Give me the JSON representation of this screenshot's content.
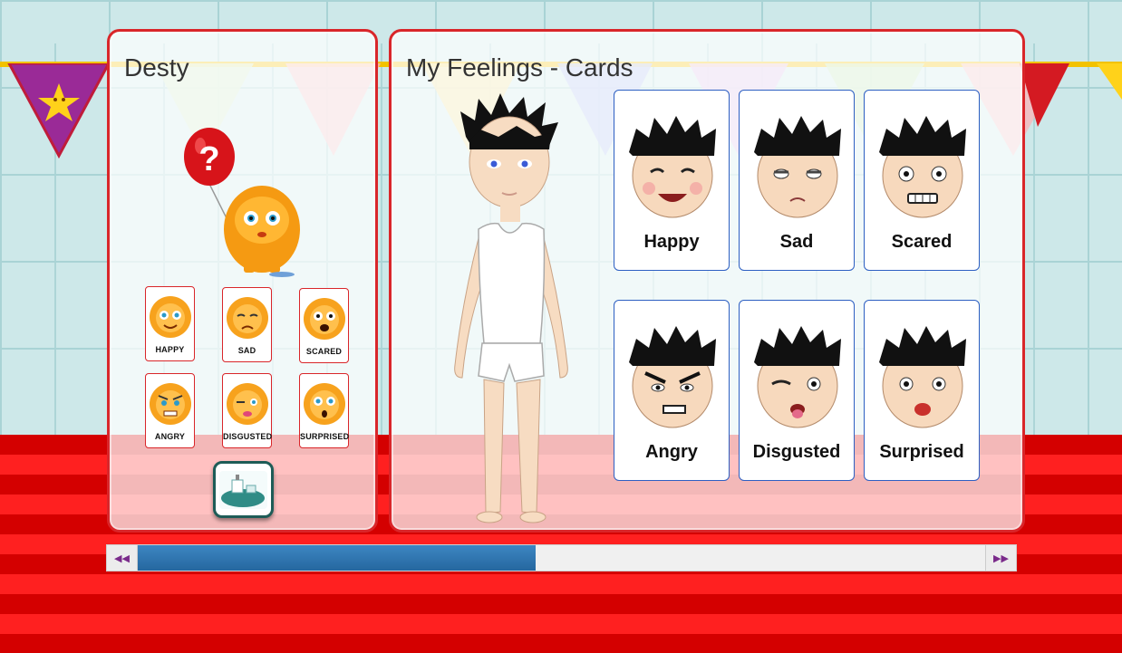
{
  "colors": {
    "accent": "#d9262a",
    "card_border": "#2d5fc2",
    "scroll_thumb": "#2c6fa8",
    "scroll_arrow": "#7a2a8a"
  },
  "left_panel": {
    "title": "Desty",
    "mascot_icon": "orange-monster-with-question-balloon-icon",
    "mini_cards": [
      {
        "label": "HAPPY",
        "icon": "happy-monster-icon"
      },
      {
        "label": "SAD",
        "icon": "sad-monster-icon"
      },
      {
        "label": "SCARED",
        "icon": "scared-monster-icon"
      },
      {
        "label": "ANGRY",
        "icon": "angry-monster-icon"
      },
      {
        "label": "DISGUSTED",
        "icon": "disgusted-monster-icon"
      },
      {
        "label": "SURPRISED",
        "icon": "surprised-monster-icon"
      }
    ],
    "game_button_icon": "landscape-scene-icon"
  },
  "right_panel": {
    "title": "My Feelings - Cards",
    "doll_icon": "paper-doll-boy-icon",
    "cards": [
      {
        "label": "Happy",
        "icon": "happy-face-icon"
      },
      {
        "label": "Sad",
        "icon": "sad-face-icon"
      },
      {
        "label": "Scared",
        "icon": "scared-face-icon"
      },
      {
        "label": "Angry",
        "icon": "angry-face-icon"
      },
      {
        "label": "Disgusted",
        "icon": "disgusted-face-icon"
      },
      {
        "label": "Surprised",
        "icon": "surprised-face-icon"
      }
    ]
  },
  "scrollbar": {
    "position_fraction": 0.0,
    "visible_fraction": 0.47,
    "left_icon": "double-chevron-left-icon",
    "right_icon": "double-chevron-right-icon"
  }
}
